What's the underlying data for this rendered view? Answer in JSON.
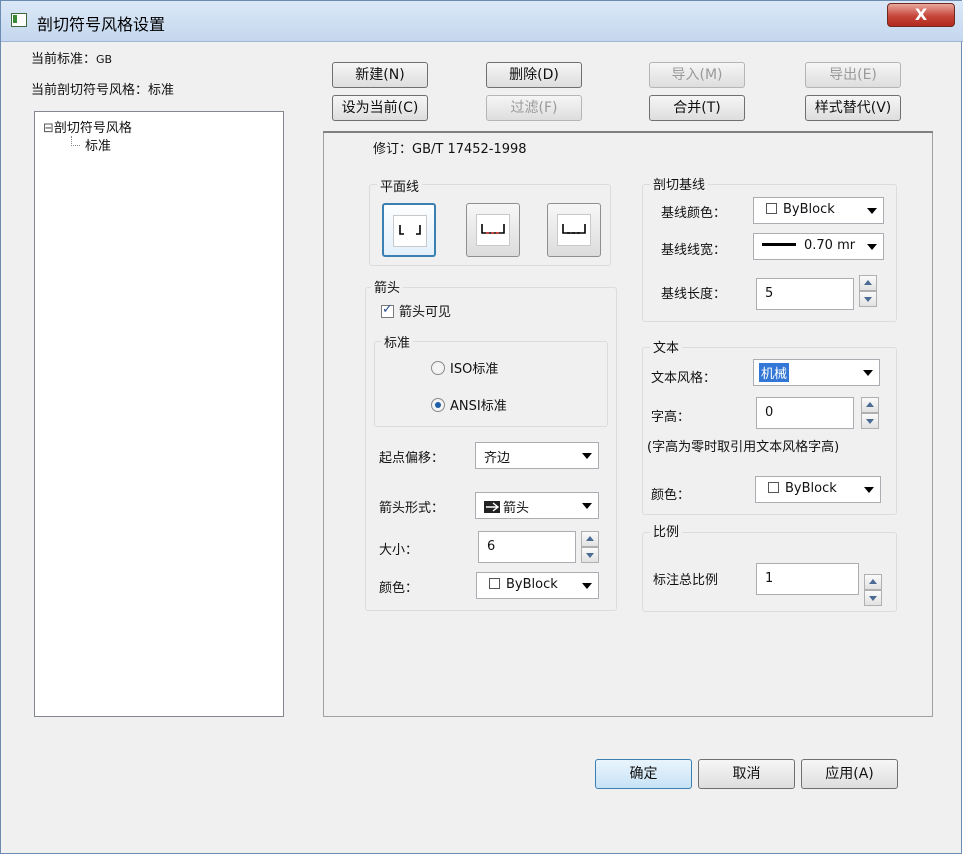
{
  "window": {
    "title": "剖切符号风格设置",
    "close_label": "X"
  },
  "header": {
    "current_standard_label": "当前标准：",
    "current_standard_value": "GB",
    "current_style_label": "当前剖切符号风格：",
    "current_style_value": "标准"
  },
  "tree": {
    "root_toggle": "⊟",
    "root": "剖切符号风格",
    "child": "标准"
  },
  "toolbar": {
    "new": "新建(N)",
    "delete": "删除(D)",
    "import": "导入(M)",
    "export": "导出(E)",
    "set_current": "设为当前(C)",
    "filter": "过滤(F)",
    "merge": "合并(T)",
    "style_override": "样式替代(V)"
  },
  "revision": "修订：GB/T 17452-1998",
  "plane_line": {
    "label": "平面线"
  },
  "arrow": {
    "label": "箭头",
    "visible_label": "箭头可见",
    "visible_checked": true,
    "standard_label": "标准",
    "iso_label": "ISO标准",
    "ansi_label": "ANSI标准",
    "selected": "ANSI",
    "start_offset_label": "起点偏移：",
    "start_offset_value": "齐边",
    "form_label": "箭头形式：",
    "form_value": "箭头",
    "size_label": "大小：",
    "size_value": "6",
    "color_label": "颜色：",
    "color_value": "ByBlock"
  },
  "baseline": {
    "label": "剖切基线",
    "color_label": "基线颜色：",
    "color_value": "ByBlock",
    "width_label": "基线线宽：",
    "width_value": "0.70 mr",
    "length_label": "基线长度：",
    "length_value": "5"
  },
  "text": {
    "label": "文本",
    "style_label": "文本风格：",
    "style_value": "机械",
    "height_label": "字高：",
    "height_value": "0",
    "note": "(字高为零时取引用文本风格字高)",
    "color_label": "颜色：",
    "color_value": "ByBlock"
  },
  "scale": {
    "label": "比例",
    "total_label": "标注总比例",
    "total_value": "1"
  },
  "footer": {
    "ok": "确定",
    "cancel": "取消",
    "apply": "应用(A)"
  }
}
